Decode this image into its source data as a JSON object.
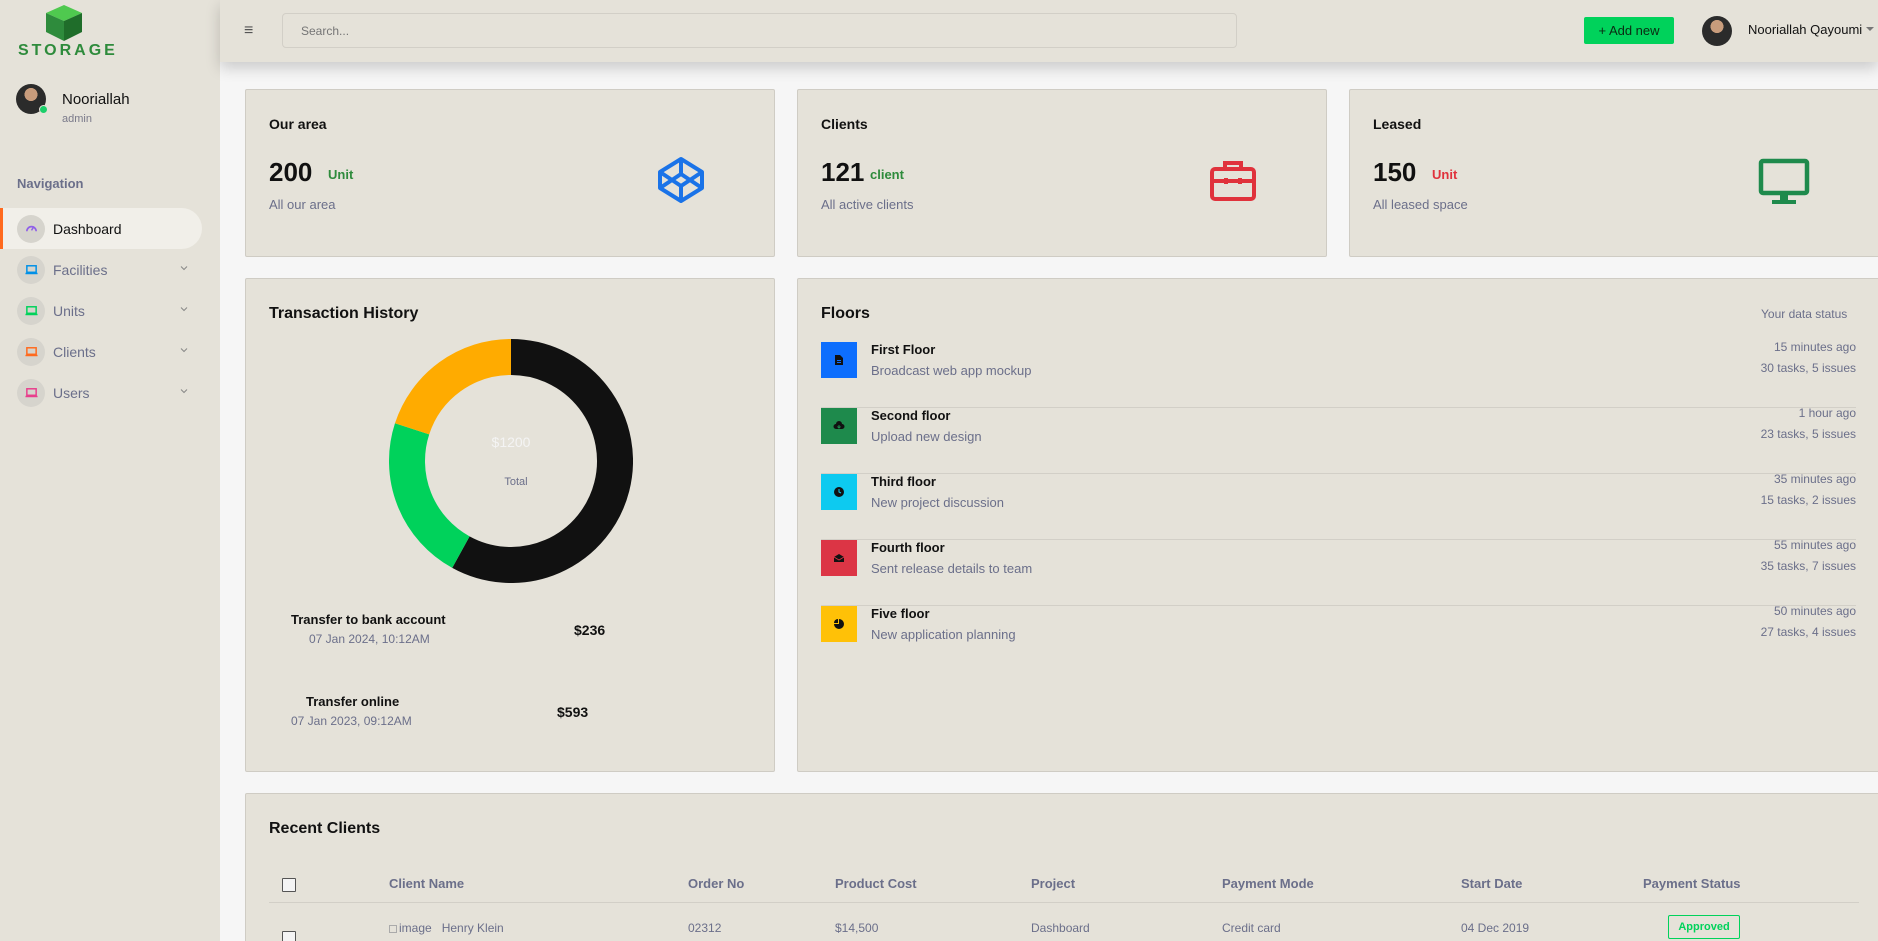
{
  "brand": {
    "logo_text": "STORAGE",
    "color": "#2e8b3c"
  },
  "sidebar": {
    "profile": {
      "name": "Nooriallah",
      "role": "admin",
      "status": "online"
    },
    "nav_heading": "Navigation",
    "items": [
      {
        "label": "Dashboard",
        "icon": "speedometer-icon",
        "icon_color": "#8f5fe8",
        "active": true,
        "expandable": false
      },
      {
        "label": "Facilities",
        "icon": "laptop-icon",
        "icon_color": "#0090e7",
        "active": false,
        "expandable": true
      },
      {
        "label": "Units",
        "icon": "laptop-icon",
        "icon_color": "#00d25b",
        "active": false,
        "expandable": true
      },
      {
        "label": "Clients",
        "icon": "laptop-icon",
        "icon_color": "#ff6a1e",
        "active": false,
        "expandable": true
      },
      {
        "label": "Users",
        "icon": "laptop-icon",
        "icon_color": "#e83e8c",
        "active": false,
        "expandable": true
      }
    ]
  },
  "topbar": {
    "search_placeholder": "Search...",
    "add_new_label": "+ Add new",
    "user_name": "Nooriallah Qayoumi"
  },
  "stats": [
    {
      "title": "Our area",
      "value": "200",
      "unit": "Unit",
      "unit_color": "#2e8b3c",
      "desc": "All our area",
      "icon": "codepen-icon",
      "icon_color": "#1a73e8"
    },
    {
      "title": "Clients",
      "value": "121",
      "unit": "client",
      "unit_color": "#2e8b3c",
      "desc": "All active clients",
      "icon": "briefcase-icon",
      "icon_color": "#e0323c"
    },
    {
      "title": "Leased",
      "value": "150",
      "unit": "Unit",
      "unit_color": "#e0323c",
      "desc": "All leased space",
      "icon": "monitor-icon",
      "icon_color": "#1e8a4c"
    }
  ],
  "transactions": {
    "title": "Transaction History",
    "total_amount": "$1200",
    "total_label": "Total",
    "items": [
      {
        "title": "Transfer to bank account",
        "date": "07 Jan 2024, 10:12AM",
        "amount": "$236"
      },
      {
        "title": "Transfer online",
        "date": "07 Jan 2023, 09:12AM",
        "amount": "$593"
      }
    ]
  },
  "chart_data": {
    "type": "pie",
    "variant": "donut",
    "title": "Transaction History",
    "series": [
      {
        "value": 58,
        "color": "#111111"
      },
      {
        "value": 22,
        "color": "#00d25b"
      },
      {
        "value": 20,
        "color": "#ffab00"
      }
    ]
  },
  "floors": {
    "title": "Floors",
    "status": "Your data status",
    "items": [
      {
        "name": "First Floor",
        "desc": "Broadcast web app mockup",
        "time": "15 minutes ago",
        "tasks": "30 tasks, 5 issues",
        "icon": "file-icon",
        "color": "#0d6efd"
      },
      {
        "name": "Second floor",
        "desc": "Upload new design",
        "time": "1 hour ago",
        "tasks": "23 tasks, 5 issues",
        "icon": "cloud-download-icon",
        "color": "#1e8a4c"
      },
      {
        "name": "Third floor",
        "desc": "New project discussion",
        "time": "35 minutes ago",
        "tasks": "15 tasks, 2 issues",
        "icon": "clock-icon",
        "color": "#0dcaf0"
      },
      {
        "name": "Fourth floor",
        "desc": "Sent release details to team",
        "time": "55 minutes ago",
        "tasks": "35 tasks, 7 issues",
        "icon": "email-icon",
        "color": "#dc3545"
      },
      {
        "name": "Five floor",
        "desc": "New application planning",
        "time": "50 minutes ago",
        "tasks": "27 tasks, 4 issues",
        "icon": "chart-pie-icon",
        "color": "#ffc107"
      }
    ]
  },
  "recent_clients": {
    "title": "Recent Clients",
    "columns": [
      "Client Name",
      "Order No",
      "Product Cost",
      "Project",
      "Payment Mode",
      "Start Date",
      "Payment Status"
    ],
    "rows": [
      {
        "image_alt": "image",
        "client": "Henry Klein",
        "order_no": "02312",
        "cost": "$14,500",
        "project": "Dashboard",
        "payment_mode": "Credit card",
        "start_date": "04 Dec 2019",
        "status": "Approved",
        "status_color": "#00d25b"
      }
    ]
  }
}
